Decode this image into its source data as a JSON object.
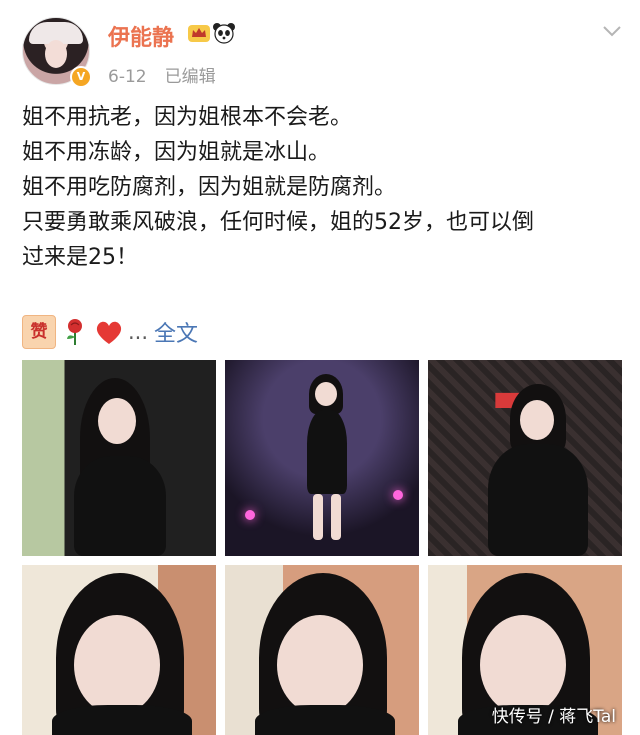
{
  "post": {
    "username": "伊能静",
    "date": "6-12",
    "edited_label": "已编辑",
    "verified_badge": "V",
    "content": [
      "姐不用抗老，因为姐根本不会老。",
      "姐不用冻龄，因为姐就是冰山。",
      "姐不用吃防腐剂，因为姐就是防腐剂。",
      "只要勇敢乘风破浪，任何时候，姐的52岁，也可以倒",
      "过来是25！"
    ]
  },
  "reactions": {
    "zan_label": "赞",
    "ellipsis": "...",
    "fulltext_label": "全文"
  },
  "photos": {
    "watermark": "快传号 / 蒋飞Tal"
  },
  "icons": {
    "crown": "crown-icon",
    "panda": "panda-icon",
    "chevron": "chevron-down-icon",
    "rose": "rose-icon",
    "heart": "heart-icon"
  },
  "colors": {
    "username": "#eb7350",
    "link": "#4b77b5",
    "meta": "#9a9a9a"
  }
}
